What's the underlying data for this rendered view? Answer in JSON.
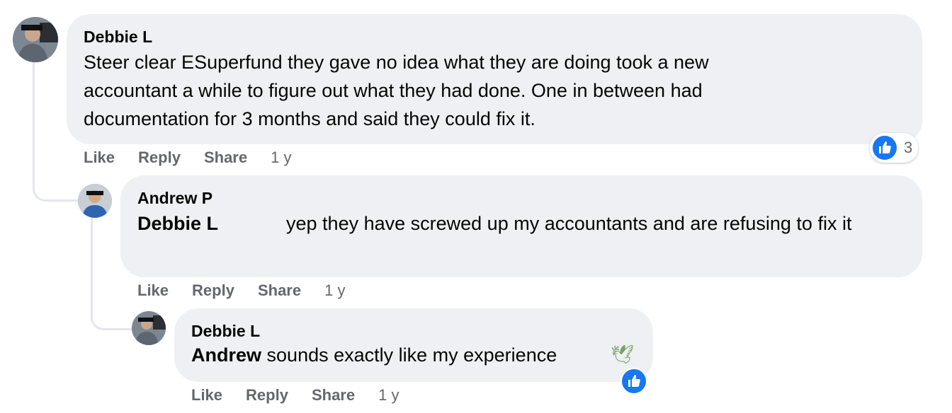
{
  "comments": [
    {
      "author": "Debbie L",
      "text": "Steer clear ESuperfund they gave no idea what they are doing took a new accountant a while to figure out what they had done. One in between had documentation for 3 months and said they could fix it.",
      "actions": {
        "like": "Like",
        "reply": "Reply",
        "share": "Share"
      },
      "time": "1 y",
      "reaction_count": "3"
    },
    {
      "author": "Andrew P",
      "mention": "Debbie L",
      "text": "yep they have screwed up my accountants and are refusing to fix it",
      "actions": {
        "like": "Like",
        "reply": "Reply",
        "share": "Share"
      },
      "time": "1 y"
    },
    {
      "author": "Debbie L",
      "mention": "Andrew",
      "text": "sounds exactly like my experience",
      "emoji": "🕊",
      "actions": {
        "like": "Like",
        "reply": "Reply",
        "share": "Share"
      },
      "time": "1 y"
    }
  ],
  "colors": {
    "bubble": "#eef0f3",
    "secondary_text": "#65676b",
    "like_blue": "#1877f2",
    "thread_line": "#e4e6eb"
  },
  "icons": [
    "avatar-debbie",
    "avatar-andrew",
    "like-thumb-icon"
  ]
}
